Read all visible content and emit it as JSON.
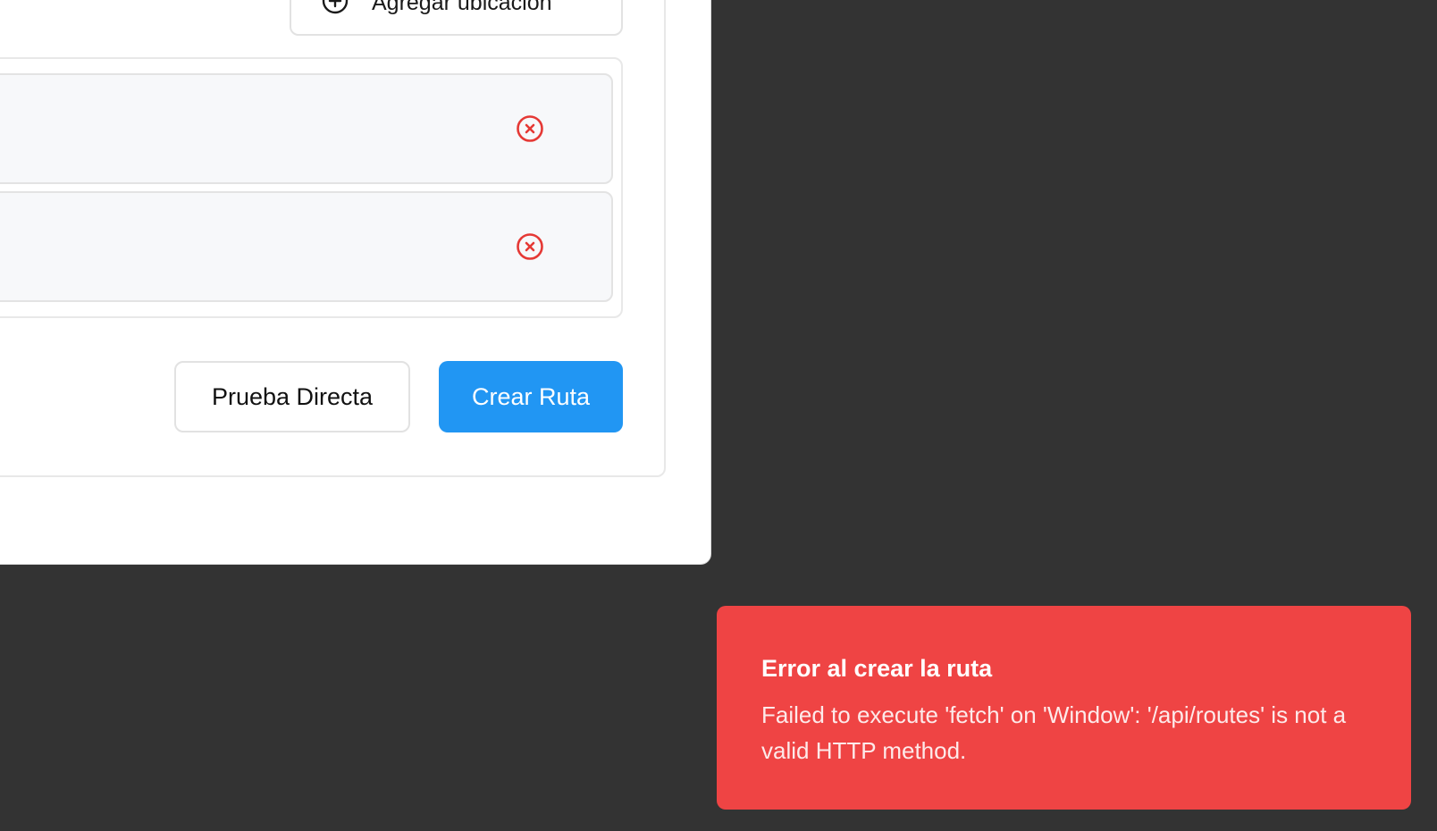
{
  "form": {
    "add_location_label": "Agregar ubicación",
    "direct_test_label": "Prueba Directa",
    "create_route_label": "Crear Ruta"
  },
  "locations": [
    {
      "remove_icon": "close-circle-icon"
    },
    {
      "remove_icon": "close-circle-icon"
    }
  ],
  "toast": {
    "title": "Error al crear la ruta",
    "message": "Failed to execute 'fetch' on 'Window': '/api/routes' is not a valid HTTP method."
  },
  "colors": {
    "primary": "#2196f3",
    "error": "#ef4444",
    "remove_icon": "#e53935",
    "backdrop": "#333333"
  }
}
